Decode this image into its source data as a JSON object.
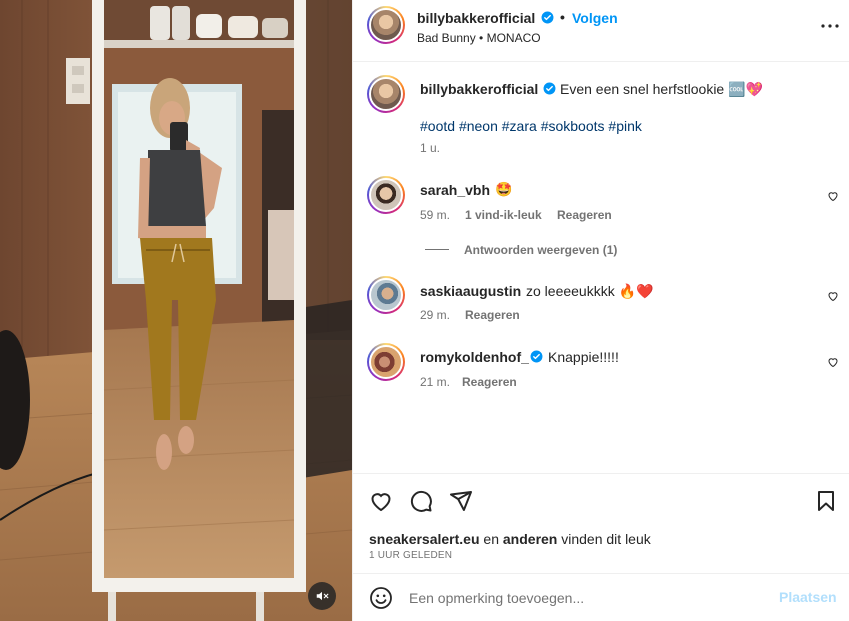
{
  "post": {
    "author": {
      "username": "billybakkerofficial",
      "verified": true,
      "follow_label": "Volgen",
      "separator": "•"
    },
    "audio": "Bad Bunny • MONACO",
    "caption": {
      "text": "Even een snel herfstlookie 🆒💖",
      "hashtags": [
        "#ootd",
        "#neon",
        "#zara",
        "#sokboots",
        "#pink"
      ],
      "time": "1 u."
    },
    "more_icon": "more-horizontal-icon"
  },
  "comments": [
    {
      "username": "sarah_vbh",
      "verified": false,
      "text": "🤩",
      "time": "59 m.",
      "likes": "1 vind-ik-leuk",
      "reply_label": "Reageren",
      "view_replies": "Antwoorden weergeven (1)"
    },
    {
      "username": "saskiaaugustin",
      "verified": false,
      "text": "zo leeeeukkkk 🔥❤️",
      "time": "29 m.",
      "reply_label": "Reageren"
    },
    {
      "username": "romykoldenhof_",
      "verified": true,
      "text": "Knappie!!!!!",
      "time": "21 m.",
      "reply_label": "Reageren"
    }
  ],
  "actions": {
    "icons": [
      "heart-icon",
      "comment-icon",
      "share-icon",
      "bookmark-icon"
    ],
    "liked_by_user": "sneakersalert.eu",
    "liked_connector": "en",
    "liked_others": "anderen",
    "liked_suffix": "vinden dit leuk",
    "posted_ago": "1 UUR GELEDEN"
  },
  "comment_box": {
    "placeholder": "Een opmerking toevoegen...",
    "post_label": "Plaatsen",
    "emoji_icon": "emoji-icon"
  },
  "media": {
    "mute_icon": "muted-speaker-icon"
  },
  "colors": {
    "link_blue": "#0095f6",
    "hashtag": "#00376b",
    "muted_text": "#737373",
    "post_button_disabled": "#b2dffc"
  }
}
